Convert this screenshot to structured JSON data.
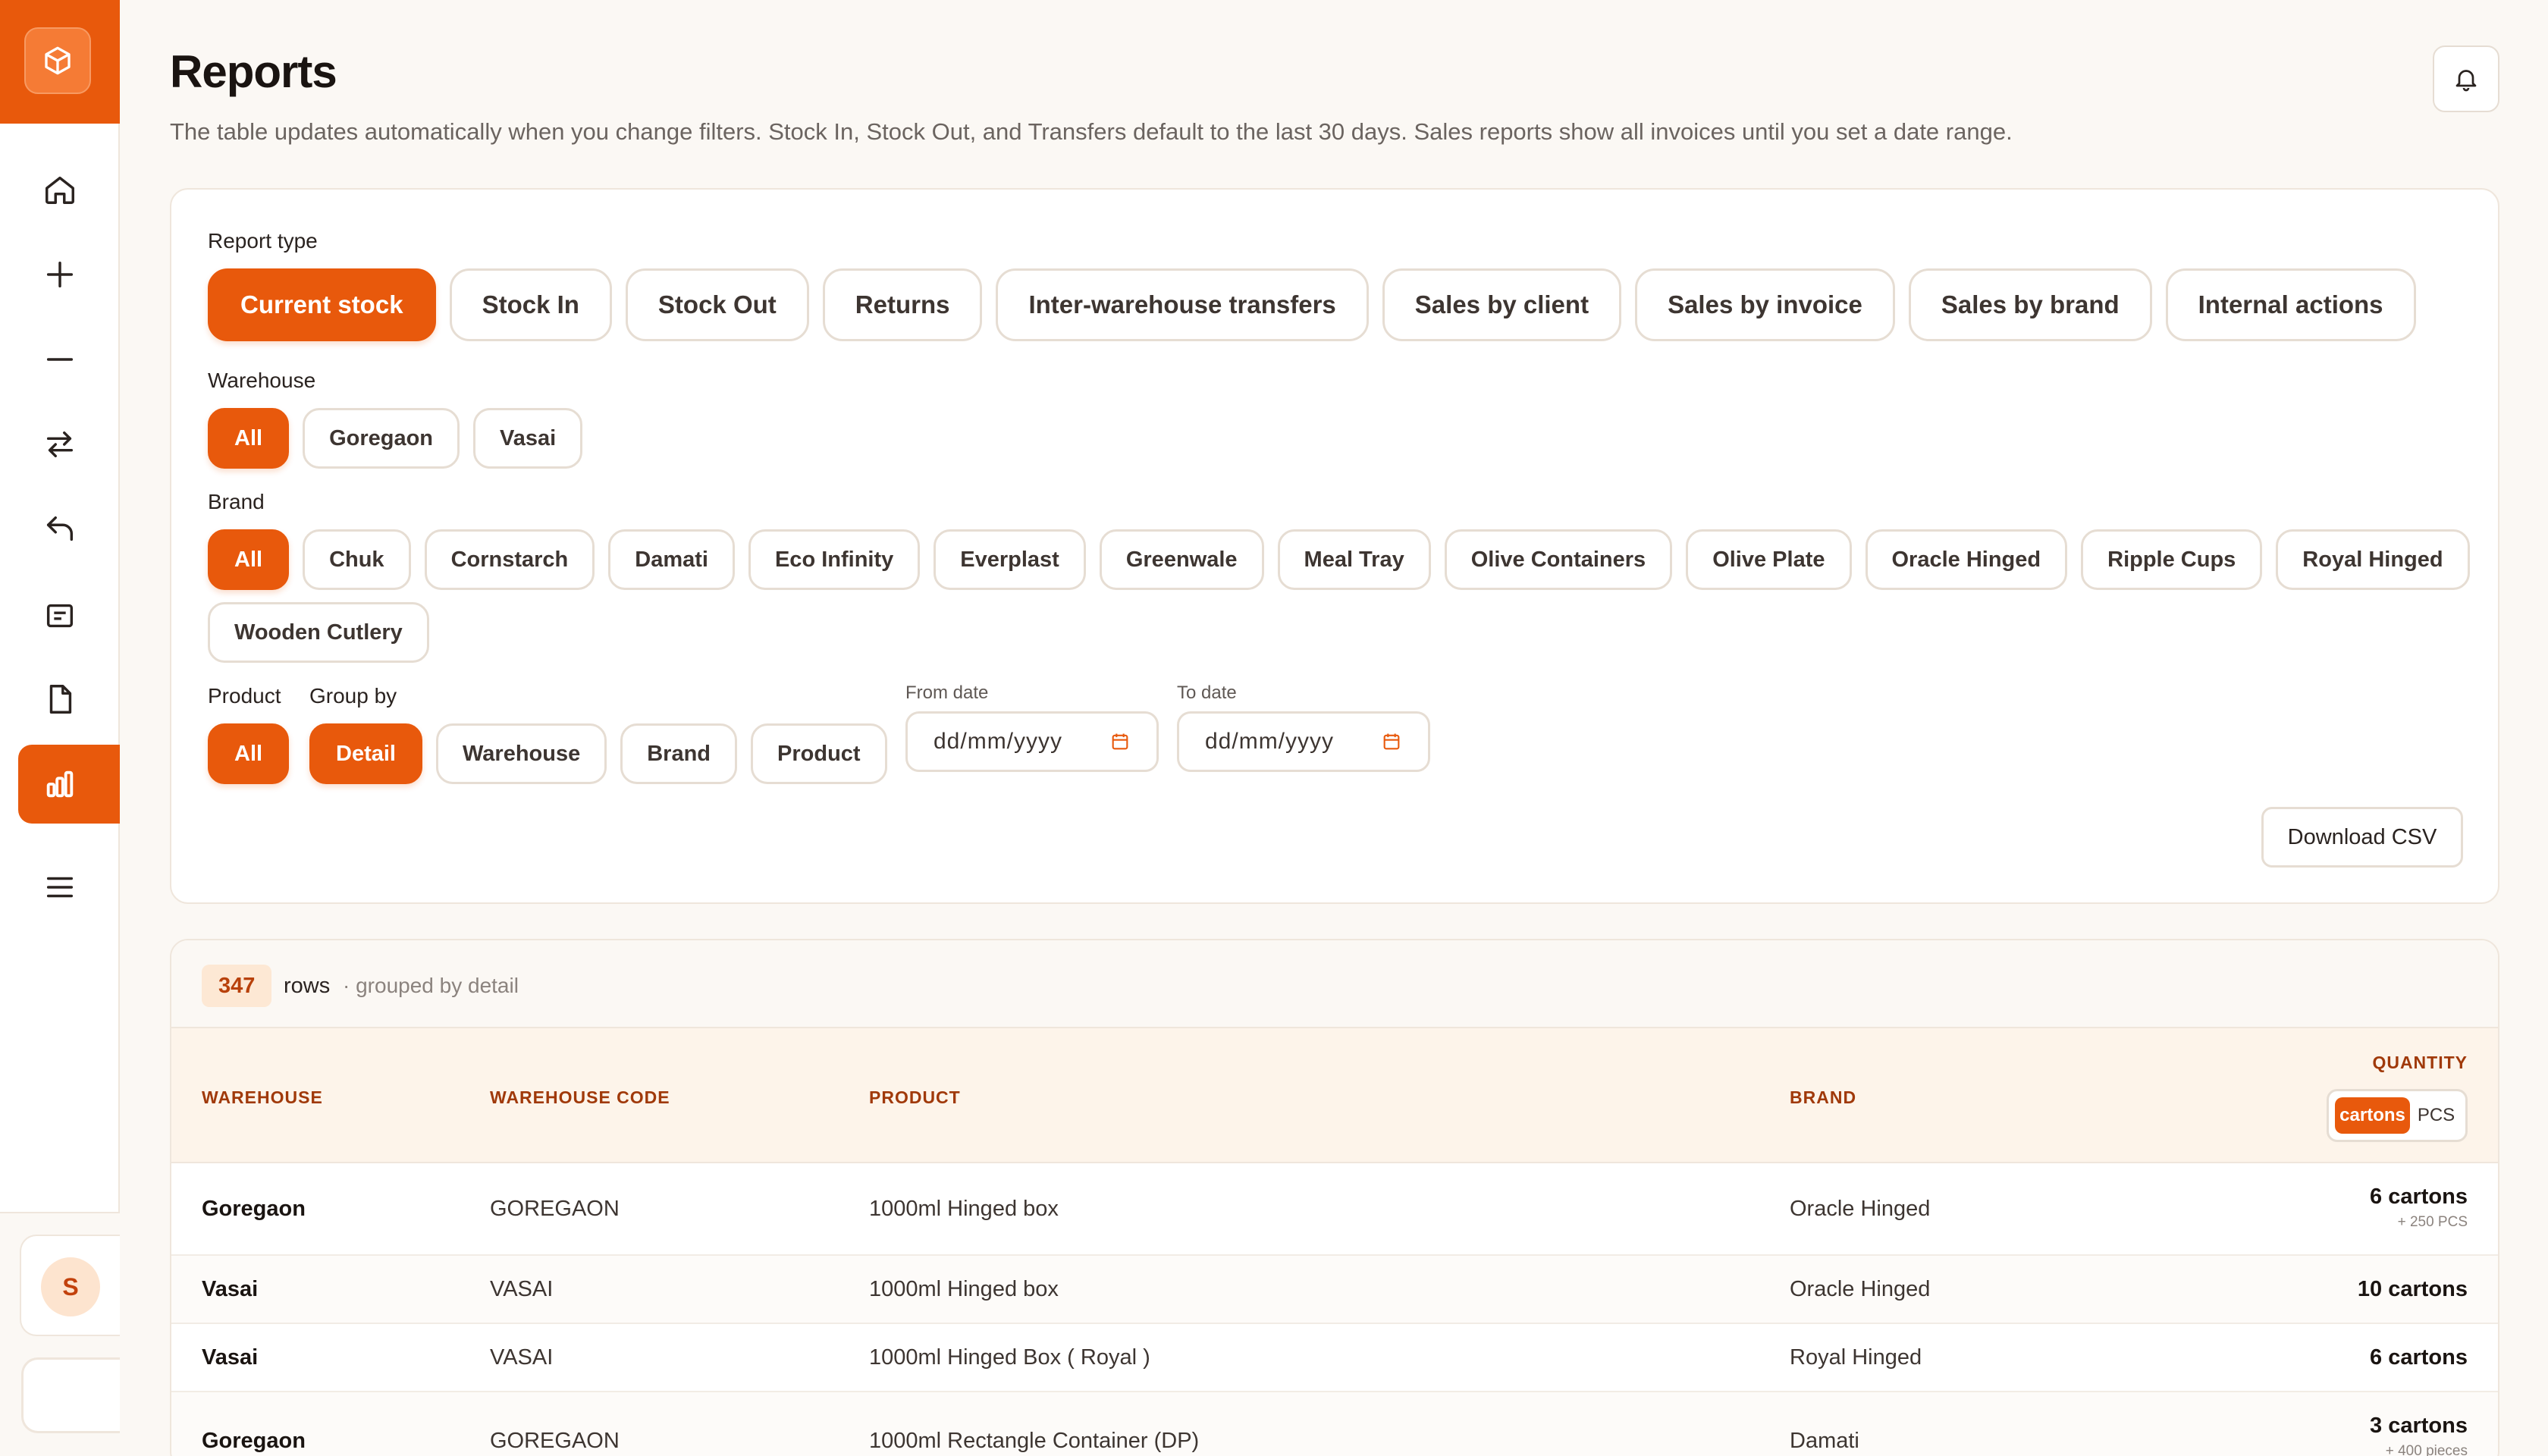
{
  "page": {
    "title": "Reports",
    "subtitle": "The table updates automatically when you change filters. Stock In, Stock Out, and Transfers default to the last 30 days. Sales reports show all invoices until you set a date range."
  },
  "sidebar": {
    "items": [
      {
        "name": "home-icon",
        "active": false
      },
      {
        "name": "plus-icon",
        "active": false
      },
      {
        "name": "minus-icon",
        "active": false
      },
      {
        "name": "transfer-icon",
        "active": false
      },
      {
        "name": "return-icon",
        "active": false
      },
      {
        "name": "invoice-icon",
        "active": false
      },
      {
        "name": "document-icon",
        "active": false
      },
      {
        "name": "bar-chart-icon",
        "active": true
      },
      {
        "name": "menu-icon",
        "active": false
      }
    ],
    "avatar_initial": "S"
  },
  "filters": {
    "report_type_label": "Report type",
    "report_types": [
      "Current stock",
      "Stock In",
      "Stock Out",
      "Returns",
      "Inter-warehouse transfers",
      "Sales by client",
      "Sales by invoice",
      "Sales by brand",
      "Internal actions"
    ],
    "report_type_selected": "Current stock",
    "warehouse_label": "Warehouse",
    "warehouses": [
      "All",
      "Goregaon",
      "Vasai"
    ],
    "warehouse_selected": "All",
    "brand_label": "Brand",
    "brands_row1": [
      "All",
      "Chuk",
      "Cornstarch",
      "Damati",
      "Eco Infinity",
      "Everplast",
      "Greenwale",
      "Meal Tray",
      "Olive Containers",
      "Olive Plate",
      "Oracle Hinged",
      "Ripple Cups",
      "Royal Hinged"
    ],
    "brands_row2": [
      "Wooden Cutlery"
    ],
    "brand_selected": "All",
    "product_label": "Product",
    "product_selected": "All",
    "group_by_label": "Group by",
    "group_by": [
      "Detail",
      "Warehouse",
      "Brand",
      "Product"
    ],
    "group_by_selected": "Detail",
    "from_date_label": "From date",
    "to_date_label": "To date",
    "date_placeholder": "dd/mm/yyyy",
    "download_label": "Download CSV"
  },
  "table": {
    "row_count": "347",
    "rows_label": "rows",
    "grouped_label": "· grouped by detail",
    "columns": {
      "warehouse": "WAREHOUSE",
      "warehouse_code": "WAREHOUSE CODE",
      "product": "PRODUCT",
      "brand": "BRAND",
      "quantity": "QUANTITY"
    },
    "unit_options": [
      "cartons",
      "PCS"
    ],
    "unit_selected": "cartons",
    "rows": [
      {
        "warehouse": "Goregaon",
        "code": "GOREGAON",
        "product": "1000ml Hinged box",
        "brand": "Oracle Hinged",
        "qty": "6 cartons",
        "qty_sub": "+ 250 PCS"
      },
      {
        "warehouse": "Vasai",
        "code": "VASAI",
        "product": "1000ml Hinged box",
        "brand": "Oracle Hinged",
        "qty": "10 cartons",
        "qty_sub": ""
      },
      {
        "warehouse": "Vasai",
        "code": "VASAI",
        "product": "1000ml Hinged Box ( Royal )",
        "brand": "Royal Hinged",
        "qty": "6 cartons",
        "qty_sub": ""
      },
      {
        "warehouse": "Goregaon",
        "code": "GOREGAON",
        "product": "1000ml Rectangle Container (DP)",
        "brand": "Damati",
        "qty": "3 cartons",
        "qty_sub": "+ 400 pieces"
      }
    ]
  },
  "colors": {
    "accent": "#e8590c",
    "accent_light": "#fde8d4",
    "header_text": "#a0390a",
    "background": "#fbf8f4"
  }
}
